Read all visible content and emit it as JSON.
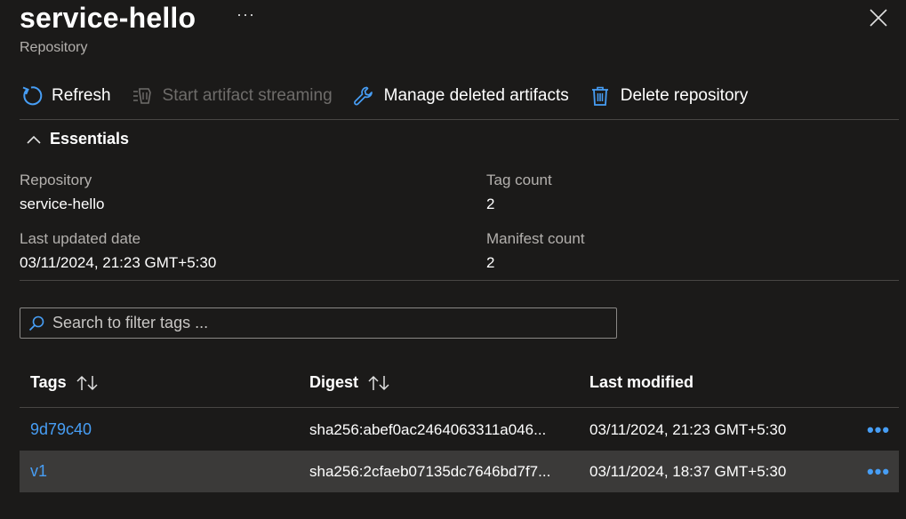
{
  "header": {
    "title": "service-hello",
    "subtitle": "Repository",
    "more_label": "···"
  },
  "toolbar": {
    "refresh": "Refresh",
    "start_streaming": "Start artifact streaming",
    "manage_deleted": "Manage deleted artifacts",
    "delete_repository": "Delete repository"
  },
  "essentials": {
    "toggle_label": "Essentials",
    "repository_label": "Repository",
    "repository_value": "service-hello",
    "last_updated_label": "Last updated date",
    "last_updated_value": "03/11/2024, 21:23 GMT+5:30",
    "tag_count_label": "Tag count",
    "tag_count_value": "2",
    "manifest_count_label": "Manifest count",
    "manifest_count_value": "2"
  },
  "search": {
    "placeholder": "Search to filter tags ..."
  },
  "table": {
    "headers": [
      "Tags",
      "Digest",
      "Last modified"
    ],
    "rows": [
      {
        "tag": "9d79c40",
        "digest": "sha256:abef0ac2464063311a046...",
        "modified": "03/11/2024, 21:23 GMT+5:30",
        "more": "•••"
      },
      {
        "tag": "v1",
        "digest": "sha256:2cfaeb07135dc7646bd7f7...",
        "modified": "03/11/2024, 18:37 GMT+5:30",
        "more": "•••"
      }
    ]
  },
  "colors": {
    "background": "#1b1a19",
    "accent": "#479ef5",
    "selected_row": "#3b3a39",
    "divider": "#484644",
    "muted_text": "#b3b0ad"
  },
  "icons": [
    "refresh-icon",
    "streaming-icon",
    "wrench-icon",
    "trash-icon",
    "chevron-up-icon",
    "search-icon",
    "sort-icon",
    "close-icon",
    "more-icon"
  ]
}
